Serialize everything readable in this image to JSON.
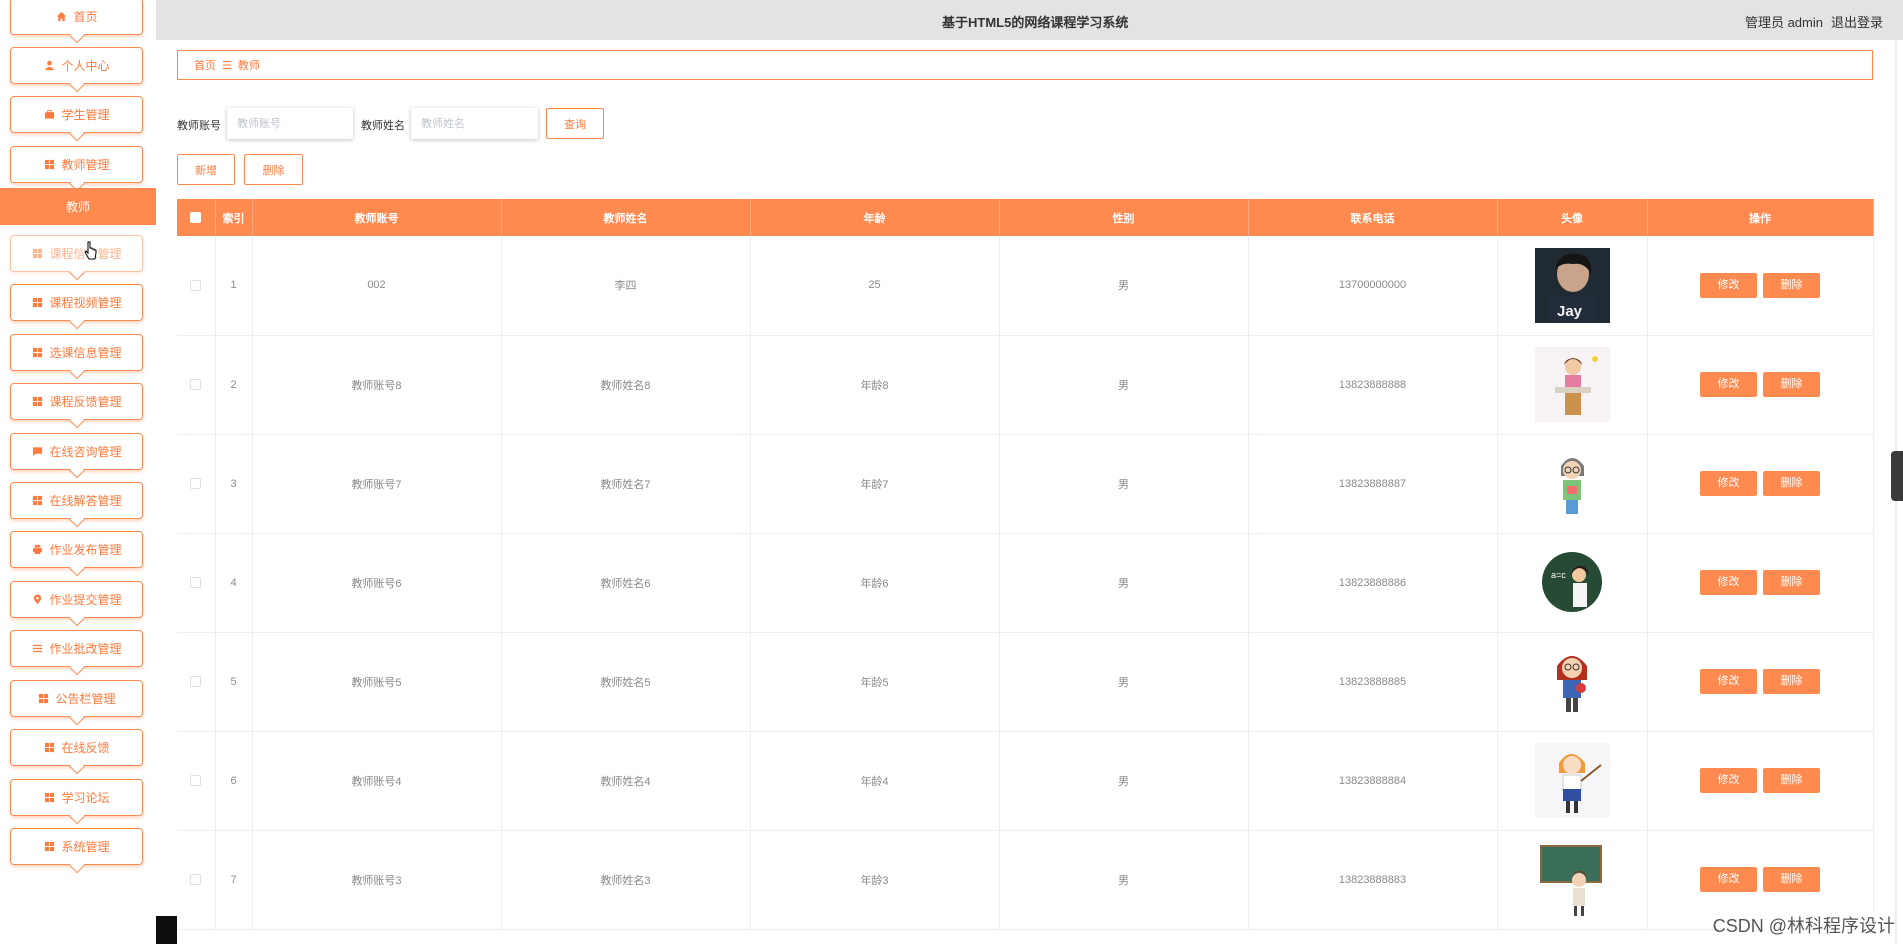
{
  "app": {
    "title": "基于HTML5的网络课程学习系统",
    "user_role": "管理员 admin",
    "logout": "退出登录"
  },
  "colors": {
    "accent": "#ff8a50",
    "topbar_bg": "#e4e2e3"
  },
  "sidebar": {
    "items": [
      {
        "label": "首页",
        "icon": "home-icon"
      },
      {
        "label": "个人中心",
        "icon": "user-icon"
      },
      {
        "label": "学生管理",
        "icon": "briefcase-icon"
      },
      {
        "label": "教师管理",
        "icon": "grid-icon"
      },
      {
        "label": "教师",
        "icon": "",
        "active": true
      },
      {
        "label": "课程信息管理",
        "icon": "grid-icon"
      },
      {
        "label": "课程视频管理",
        "icon": "grid-icon"
      },
      {
        "label": "选课信息管理",
        "icon": "grid-icon"
      },
      {
        "label": "课程反馈管理",
        "icon": "grid-icon"
      },
      {
        "label": "在线咨询管理",
        "icon": "chat-icon"
      },
      {
        "label": "在线解答管理",
        "icon": "grid-icon"
      },
      {
        "label": "作业发布管理",
        "icon": "printer-icon"
      },
      {
        "label": "作业提交管理",
        "icon": "location-icon"
      },
      {
        "label": "作业批改管理",
        "icon": "list-icon"
      },
      {
        "label": "公告栏管理",
        "icon": "grid-icon"
      },
      {
        "label": "在线反馈",
        "icon": "grid-icon"
      },
      {
        "label": "学习论坛",
        "icon": "grid-icon"
      },
      {
        "label": "系统管理",
        "icon": "grid-icon"
      }
    ]
  },
  "breadcrumb": {
    "home": "首页",
    "separator": "☰",
    "current": "教师"
  },
  "search": {
    "account_label": "教师账号",
    "account_placeholder": "教师账号",
    "name_label": "教师姓名",
    "name_placeholder": "教师姓名",
    "query_button": "查询"
  },
  "actions": {
    "add": "新增",
    "delete": "删除"
  },
  "table": {
    "headers": [
      "索引",
      "教师账号",
      "教师姓名",
      "年龄",
      "性别",
      "联系电话",
      "头像",
      "操作"
    ],
    "edit_label": "修改",
    "delete_label": "删除",
    "rows": [
      {
        "index": "1",
        "account": "002",
        "name": "李四",
        "age": "25",
        "gender": "男",
        "phone": "13700000000",
        "avatar": "avatar-photo-jay"
      },
      {
        "index": "2",
        "account": "教师账号8",
        "name": "教师姓名8",
        "age": "年龄8",
        "gender": "男",
        "phone": "13823888888",
        "avatar": "avatar-teacher-reading"
      },
      {
        "index": "3",
        "account": "教师账号7",
        "name": "教师姓名7",
        "age": "年龄7",
        "gender": "男",
        "phone": "13823888887",
        "avatar": "avatar-teacher-glasses"
      },
      {
        "index": "4",
        "account": "教师账号6",
        "name": "教师姓名6",
        "age": "年龄6",
        "gender": "男",
        "phone": "13823888886",
        "avatar": "avatar-teacher-chalkboard"
      },
      {
        "index": "5",
        "account": "教师账号5",
        "name": "教师姓名5",
        "age": "年龄5",
        "gender": "男",
        "phone": "13823888885",
        "avatar": "avatar-teacher-redhair"
      },
      {
        "index": "6",
        "account": "教师账号4",
        "name": "教师姓名4",
        "age": "年龄4",
        "gender": "男",
        "phone": "13823888884",
        "avatar": "avatar-teacher-pointer"
      },
      {
        "index": "7",
        "account": "教师账号3",
        "name": "教师姓名3",
        "age": "年龄3",
        "gender": "男",
        "phone": "13823888883",
        "avatar": "avatar-teacher-board"
      }
    ]
  },
  "watermark": "CSDN @林科程序设计"
}
